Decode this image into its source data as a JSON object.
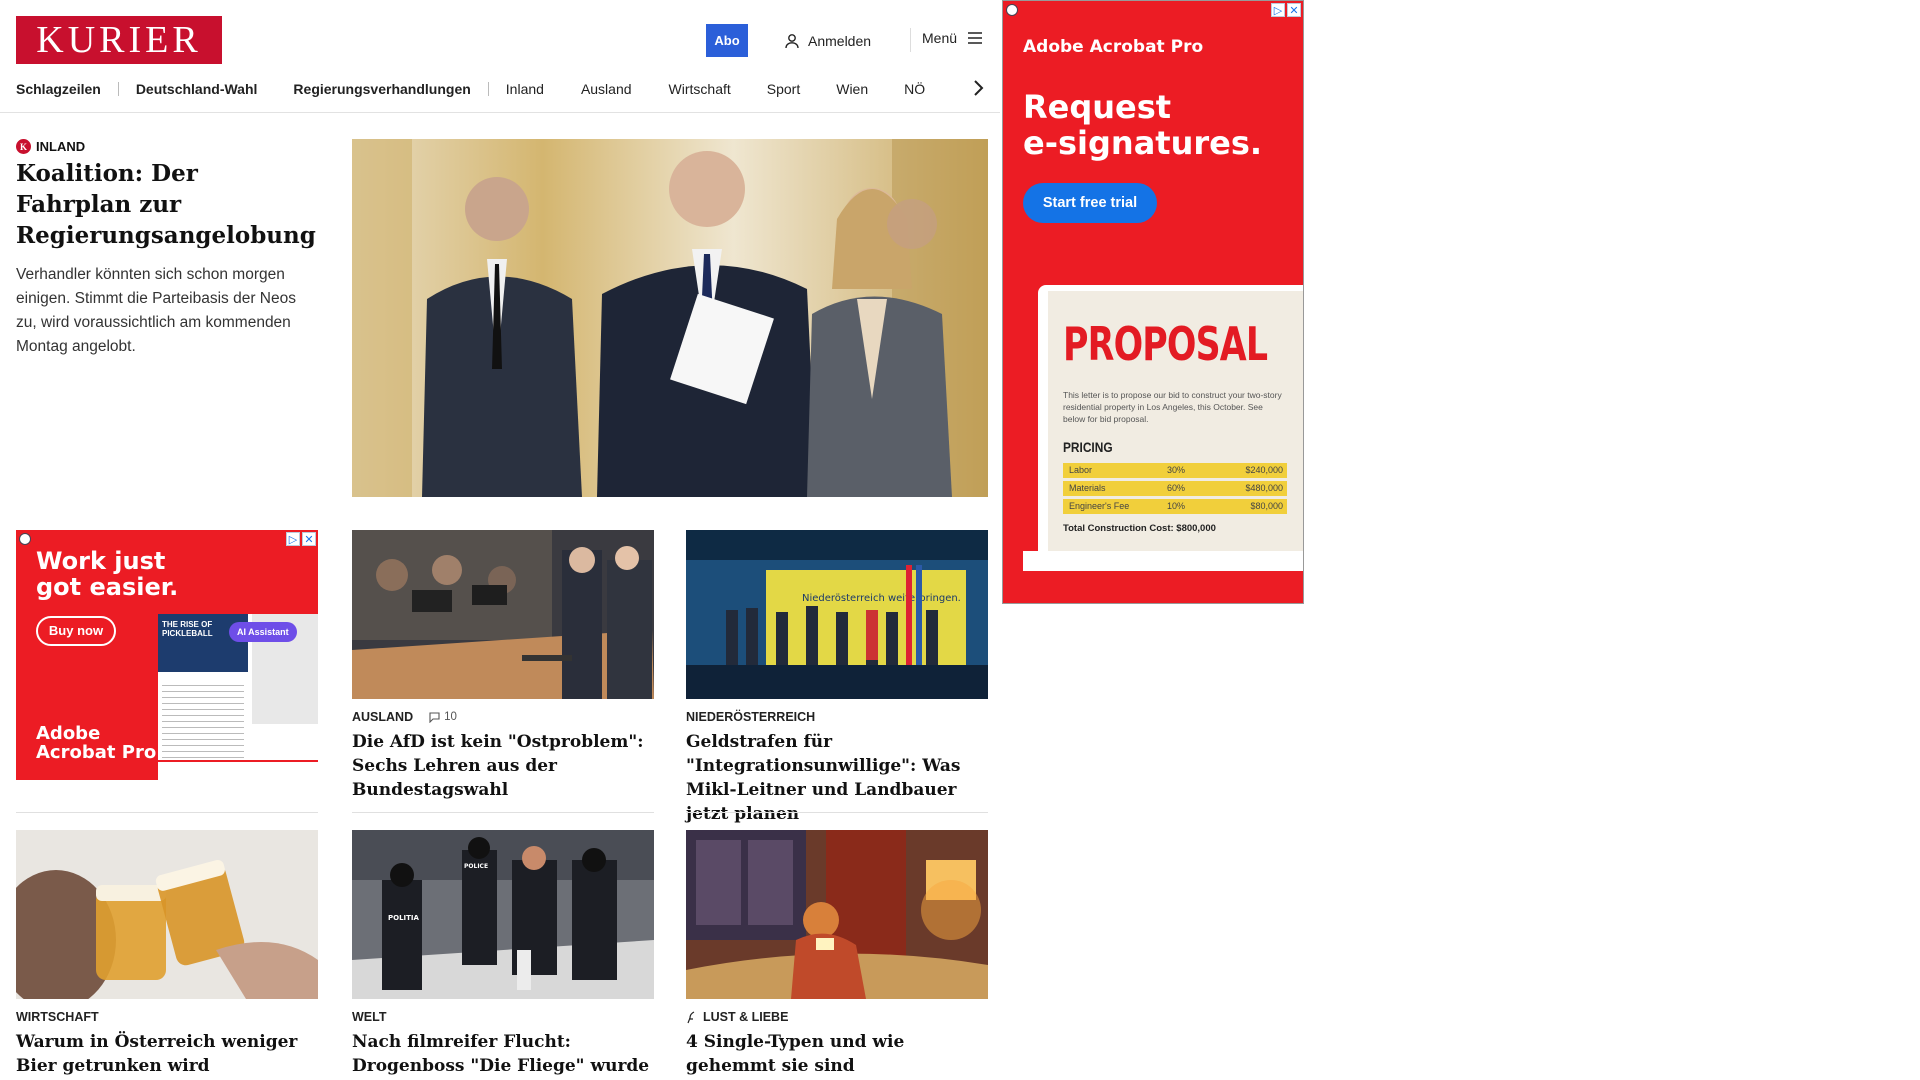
{
  "header": {
    "logo": "KURIER",
    "abo": "Abo",
    "login": "Anmelden",
    "menu": "Menü"
  },
  "nav": {
    "items": [
      "Schlagzeilen",
      "Deutschland-Wahl",
      "Regierungsverhandlungen",
      "Inland",
      "Ausland",
      "Wirtschaft",
      "Sport",
      "Wien",
      "NÖ"
    ]
  },
  "lead": {
    "category": "INLAND",
    "title": "Koalition: Der Fahrplan zur Regierungsangelobung",
    "teaser": "Verhandler könnten sich schon morgen einigen. Stimmt die Parteibasis der Neos zu, wird voraussichtlich am kommenden Montag angelobt."
  },
  "cards": [
    {
      "category": "AUSLAND",
      "comments": "10",
      "headline": "Die AfD ist kein \"Ostproblem\": Sechs Lehren aus der Bundestagswahl"
    },
    {
      "category": "NIEDERÖSTERREICH",
      "headline": "Geldstrafen für \"Integrationsunwillige\": Was Mikl-Leitner und Landbauer jetzt planen",
      "image_text": "Niederösterreich weiterbringen."
    },
    {
      "category": "WIRTSCHAFT",
      "headline": "Warum in Österreich weniger Bier getrunken wird"
    },
    {
      "category": "WELT",
      "headline": "Nach filmreifer Flucht: Drogenboss \"Die Fliege\" wurde geschnappt",
      "image_text": [
        "POLICE",
        "POLITIA"
      ]
    },
    {
      "category": "LUST & LIEBE",
      "headline": "4 Single-Typen und wie gehemmt sie sind"
    }
  ],
  "ad_small": {
    "headline_1": "Work just",
    "headline_2": "got easier.",
    "cta": "Buy now",
    "brand_1": "Adobe",
    "brand_2": "Acrobat Pro",
    "doc_title_1": "THE RISE OF",
    "doc_title_2": "PICKLEBALL",
    "assistant": "AI Assistant"
  },
  "ad_big": {
    "brand": "Adobe Acrobat Pro",
    "headline_1": "Request",
    "headline_2": "e-signatures.",
    "cta": "Start free trial",
    "doc": {
      "title": "PROPOSAL",
      "body": "This letter is to propose our bid to construct your two-story residential property in Los Angeles, this October. See below for bid proposal.",
      "section": "PRICING",
      "rows": [
        [
          "Labor",
          "30%",
          "$240,000"
        ],
        [
          "Materials",
          "60%",
          "$480,000"
        ],
        [
          "Engineer's Fee",
          "10%",
          "$80,000"
        ]
      ],
      "total": "Total Construction Cost: $800,000"
    }
  }
}
